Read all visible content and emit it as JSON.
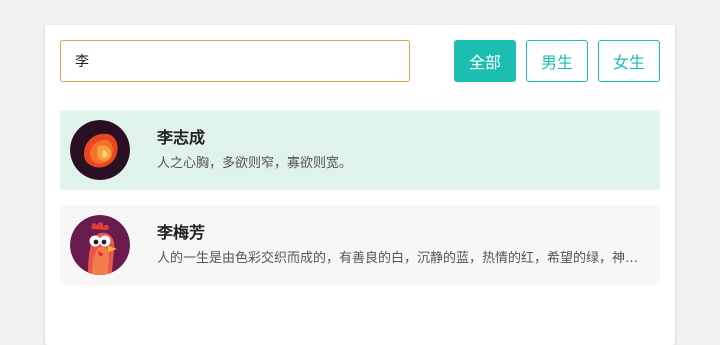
{
  "search": {
    "value": "李"
  },
  "filters": {
    "all_label": "全部",
    "male_label": "男生",
    "female_label": "女生",
    "active": "all",
    "accent_color": "#1cbeb1"
  },
  "results": [
    {
      "name": "李志成",
      "description": "人之心胸，多欲则窄，寡欲则宽。",
      "avatar_icon": "lion-avatar-icon",
      "highlighted": true
    },
    {
      "name": "李梅芳",
      "description": "人的一生是由色彩交织而成的，有善良的白，沉静的蓝，热情的红，希望的绿，神秘的紫。",
      "avatar_icon": "rooster-avatar-icon",
      "highlighted": false
    }
  ]
}
